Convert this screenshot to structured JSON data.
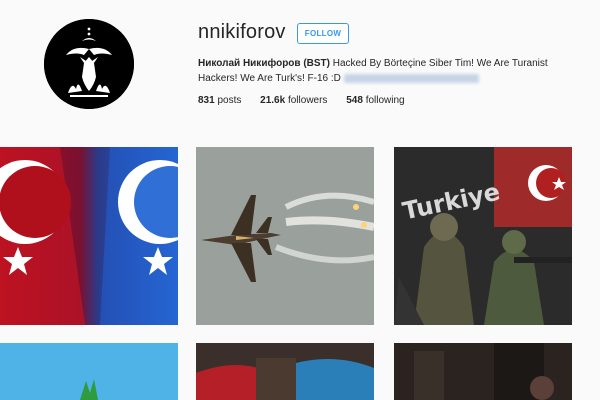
{
  "profile": {
    "username": "nnikiforov",
    "follow_label": "FOLLOW",
    "bio_name": "Николай Никифоров (BST)",
    "bio_text": " Hacked By Börteçine Siber Tim! We Are Turanist Hackers! We Are Turk's! F-16 :D ",
    "stats": {
      "posts_count": "831",
      "posts_label": "posts",
      "followers_count": "21.6k",
      "followers_label": "followers",
      "following_count": "548",
      "following_label": "following"
    }
  },
  "posts": [
    {
      "icon": "turkish-flag-image"
    },
    {
      "icon": "f16-jet-image"
    },
    {
      "icon": "turkish-soldiers-image",
      "overlay_text": "Turkiye"
    },
    {
      "icon": "turquoise-flag-image"
    },
    {
      "icon": "flag-crowd-image"
    },
    {
      "icon": "night-street-image"
    }
  ],
  "colors": {
    "accent": "#3897f0",
    "text": "#262626",
    "background": "#fafafa",
    "turkish_red": "#c8102e"
  }
}
